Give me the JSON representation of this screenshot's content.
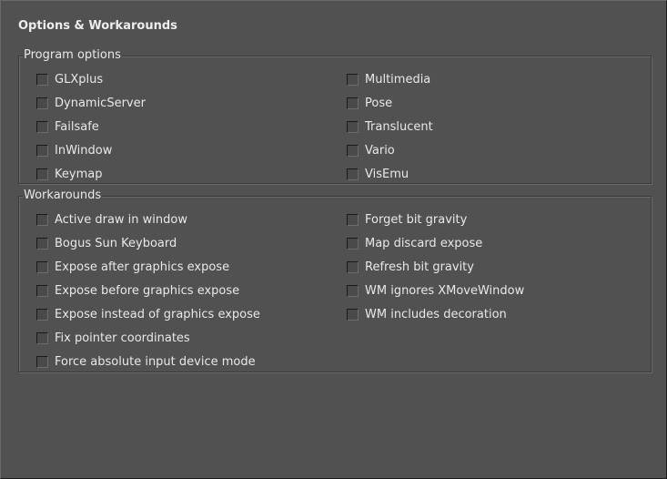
{
  "title": "Options & Workarounds",
  "program_options": {
    "legend": "Program options",
    "left": [
      {
        "label": "GLXplus",
        "checked": false
      },
      {
        "label": "DynamicServer",
        "checked": false
      },
      {
        "label": "Failsafe",
        "checked": false
      },
      {
        "label": "InWindow",
        "checked": false
      },
      {
        "label": "Keymap",
        "checked": false
      }
    ],
    "right": [
      {
        "label": "Multimedia",
        "checked": false
      },
      {
        "label": "Pose",
        "checked": false
      },
      {
        "label": "Translucent",
        "checked": false
      },
      {
        "label": "Vario",
        "checked": false
      },
      {
        "label": "VisEmu",
        "checked": false
      }
    ]
  },
  "workarounds": {
    "legend": "Workarounds",
    "left": [
      {
        "label": "Active draw in window",
        "checked": false
      },
      {
        "label": "Bogus Sun Keyboard",
        "checked": false
      },
      {
        "label": "Expose after graphics expose",
        "checked": false
      },
      {
        "label": "Expose before graphics expose",
        "checked": false
      },
      {
        "label": "Expose instead of graphics expose",
        "checked": false
      },
      {
        "label": "Fix pointer coordinates",
        "checked": false
      },
      {
        "label": "Force absolute input device mode",
        "checked": false
      }
    ],
    "right": [
      {
        "label": "Forget bit gravity",
        "checked": false
      },
      {
        "label": "Map discard expose",
        "checked": false
      },
      {
        "label": "Refresh bit gravity",
        "checked": false
      },
      {
        "label": "WM ignores XMoveWindow",
        "checked": false
      },
      {
        "label": "WM includes decoration",
        "checked": false
      }
    ]
  }
}
